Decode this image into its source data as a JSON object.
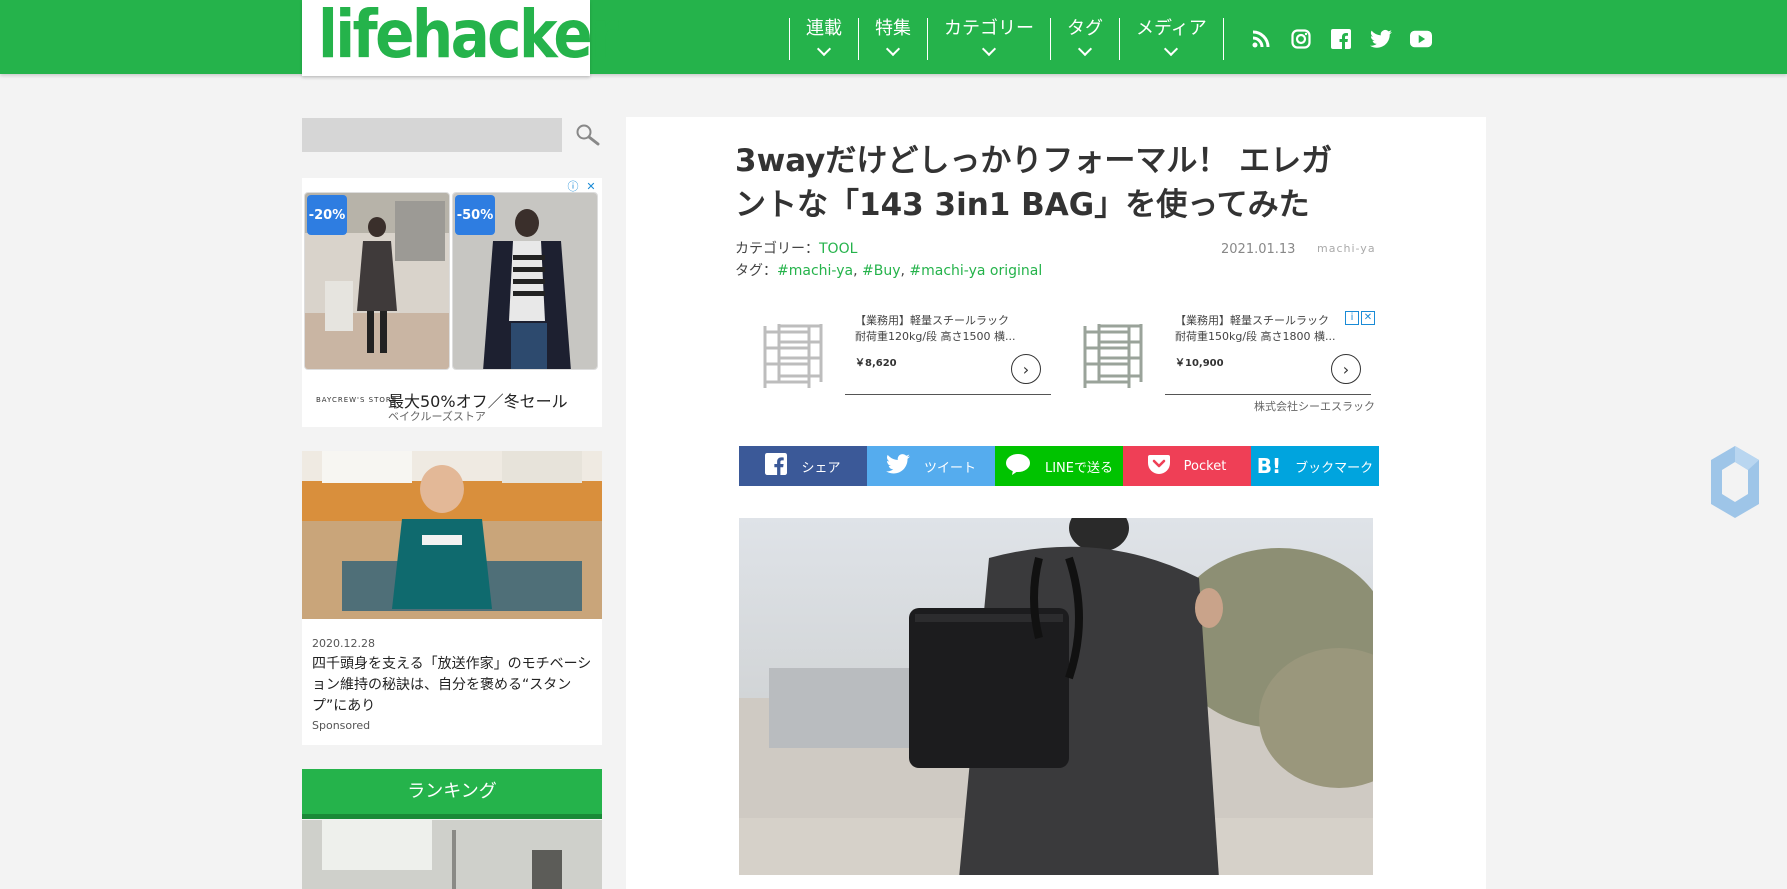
{
  "header": {
    "logo": "lifehacker",
    "nav": [
      {
        "label": "連載"
      },
      {
        "label": "特集"
      },
      {
        "label": "カテゴリー"
      },
      {
        "label": "タグ"
      },
      {
        "label": "メディア"
      }
    ],
    "social_icons": [
      "rss-icon",
      "instagram-icon",
      "facebook-icon",
      "twitter-icon",
      "youtube-icon"
    ],
    "brand_color": "#25b34b"
  },
  "sidebar": {
    "search": {
      "placeholder": "",
      "value": ""
    },
    "ad": {
      "products": [
        {
          "badge": "-20%"
        },
        {
          "badge": "-50%"
        }
      ],
      "brand": "BAYCREW'S STORE",
      "copy": "最大50%オフ／冬セール",
      "advertiser": "ベイクルーズストア"
    },
    "sponsored": {
      "date": "2020.12.28",
      "title": "四千頭身を支える「放送作家」のモチベーション維持の秘訣は、自分を褒める“スタンプ”にあり",
      "tag": "Sponsored"
    },
    "ranking": {
      "title": "ランキング"
    }
  },
  "article": {
    "title": "3wayだけどしっかりフォーマル！ エレガントな「143 3in1 BAG」を使ってみた",
    "category_label": "カテゴリー：",
    "category": "TOOL",
    "tags_label": "タグ：",
    "tags": [
      "#machi-ya",
      "#Buy",
      "#machi-ya original"
    ],
    "date": "2021.01.13",
    "publisher": "machi-ya",
    "native_ad": {
      "items": [
        {
          "line1": "【業務用】軽量スチールラック",
          "line2": "耐荷重120kg/段 高さ1500 横...",
          "price": "￥8,620"
        },
        {
          "line1": "【業務用】軽量スチールラック",
          "line2": "耐荷重150kg/段 高さ1800 横...",
          "price": "￥10,900"
        }
      ],
      "advertiser": "株式会社シーエスラック"
    },
    "share": [
      {
        "label": "シェア",
        "icon": "facebook-icon",
        "color": "#3b5998"
      },
      {
        "label": "ツイート",
        "icon": "twitter-icon",
        "color": "#55acee"
      },
      {
        "label": "LINEで送る",
        "icon": "line-icon",
        "color": "#00c300"
      },
      {
        "label": "Pocket",
        "icon": "pocket-icon",
        "color": "#ef3f56"
      },
      {
        "label": "ブックマーク",
        "icon": "hatena-bookmark-icon",
        "color": "#00a4de"
      }
    ]
  }
}
